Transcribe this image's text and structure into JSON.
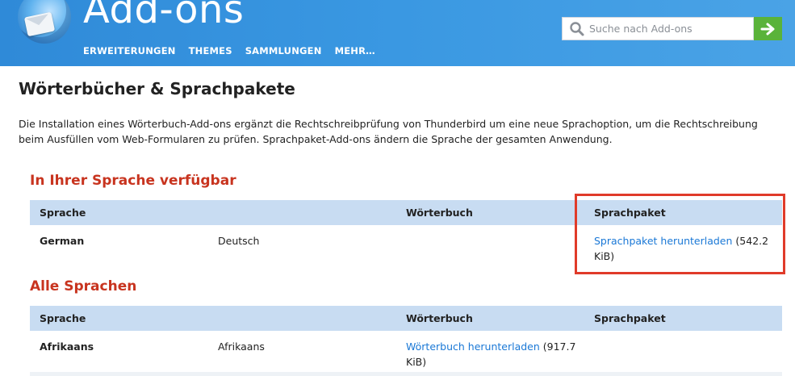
{
  "header": {
    "site_title": "Add-ons",
    "nav": [
      "ERWEITERUNGEN",
      "THEMES",
      "SAMMLUNGEN",
      "MEHR…"
    ],
    "search": {
      "placeholder": "Suche nach Add-ons",
      "value": ""
    },
    "icons": {
      "logo": "thunderbird-logo",
      "search": "search-icon",
      "go": "arrow-right-icon"
    },
    "colors": {
      "header_bg": "#3a98e2",
      "go_button": "#5ab33a"
    }
  },
  "main": {
    "title": "Wörterbücher & Sprachpakete",
    "intro": "Die Installation eines Wörterbuch-Add-ons ergänzt die Rechtschreibprüfung von Thunderbird um eine neue Sprachoption, um die Rechtschreibung beim Ausfüllen vom Web-Formularen zu prüfen. Sprachpaket-Add-ons ändern die Sprache der gesamten Anwendung.",
    "sections": [
      {
        "title": "In Ihrer Sprache verfügbar",
        "columns": [
          "Sprache",
          "",
          "Wörterbuch",
          "Sprachpaket"
        ],
        "rows": [
          {
            "language": "German",
            "native": "Deutsch",
            "dictionary_link": "",
            "dictionary_size": "",
            "langpack_link": "Sprachpaket herunterladen",
            "langpack_size": " (542.2 KiB)"
          }
        ]
      },
      {
        "title": "Alle Sprachen",
        "columns": [
          "Sprache",
          "",
          "Wörterbuch",
          "Sprachpaket"
        ],
        "rows": [
          {
            "language": "Afrikaans",
            "native": "Afrikaans",
            "dictionary_link": "Wörterbuch herunterladen",
            "dictionary_size": " (917.7 KiB)",
            "langpack_link": "",
            "langpack_size": ""
          }
        ]
      }
    ],
    "colors": {
      "section_title": "#c8341f",
      "table_header": "#c8dcf2",
      "link": "#1a78d6",
      "highlight": "#e03b2a"
    }
  }
}
